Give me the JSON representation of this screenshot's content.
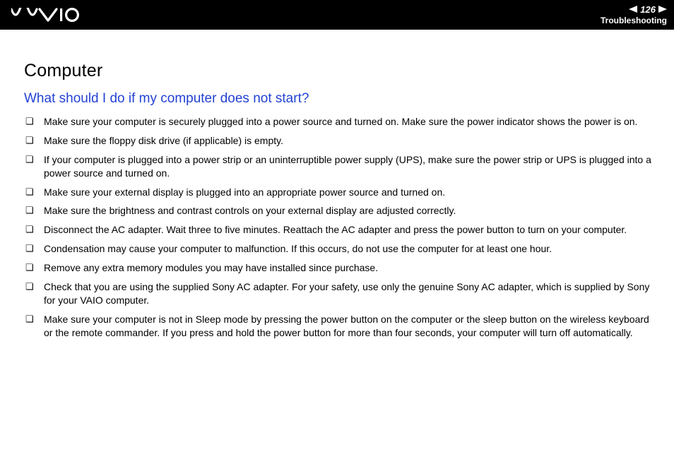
{
  "header": {
    "page_number": "126",
    "section": "Troubleshooting"
  },
  "content": {
    "heading": "Computer",
    "subheading": "What should I do if my computer does not start?",
    "items": [
      "Make sure your computer is securely plugged into a power source and turned on. Make sure the power indicator shows the power is on.",
      "Make sure the floppy disk drive (if applicable) is empty.",
      "If your computer is plugged into a power strip or an uninterruptible power supply (UPS), make sure the power strip or UPS is plugged into a power source and turned on.",
      "Make sure your external display is plugged into an appropriate power source and turned on.",
      "Make sure the brightness and contrast controls on your external display are adjusted correctly.",
      "Disconnect the AC adapter. Wait three to five minutes. Reattach the AC adapter and press the power button to turn on your computer.",
      "Condensation may cause your computer to malfunction. If this occurs, do not use the computer for at least one hour.",
      "Remove any extra memory modules you may have installed since purchase.",
      "Check that you are using the supplied Sony AC adapter. For your safety, use only the genuine Sony AC adapter, which is supplied by Sony for your VAIO computer.",
      "Make sure your computer is not in Sleep mode by pressing the power button on the computer or the sleep button on the wireless keyboard or the remote commander. If you press and hold the power button for more than four seconds, your computer will turn off automatically."
    ]
  }
}
